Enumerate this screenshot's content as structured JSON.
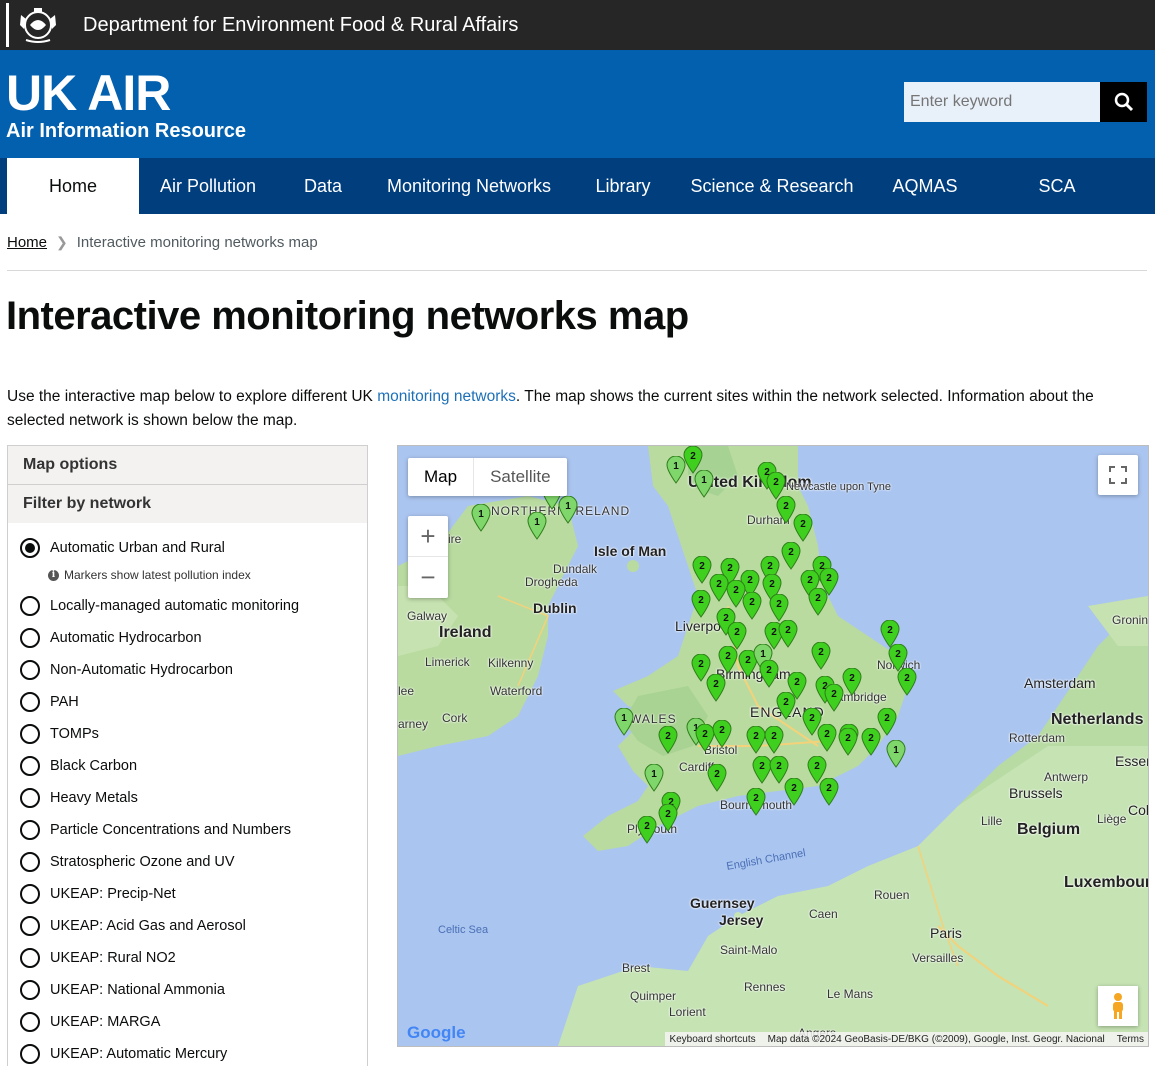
{
  "govbar": {
    "title": "Department for Environment Food & Rural Affairs"
  },
  "brand": {
    "title": "UK AIR",
    "subtitle": "Air Information Resource"
  },
  "search": {
    "placeholder": "Enter keyword"
  },
  "nav": [
    {
      "label": "Home",
      "active": true
    },
    {
      "label": "Air Pollution"
    },
    {
      "label": "Data"
    },
    {
      "label": "Monitoring Networks"
    },
    {
      "label": "Library"
    },
    {
      "label": "Science & Research"
    },
    {
      "label": "AQMAS"
    },
    {
      "label": "SCA"
    }
  ],
  "breadcrumb": {
    "home": "Home",
    "current": "Interactive monitoring networks map"
  },
  "page": {
    "title": "Interactive monitoring networks map",
    "intro_before": "Use the interactive map below to explore different UK ",
    "intro_link": "monitoring networks",
    "intro_after": ". The map shows the current sites within the network selected. Information about the selected network is shown below the map."
  },
  "options": {
    "heading": "Map options",
    "filter_heading": "Filter by network",
    "note": "Markers show latest pollution index",
    "networks": [
      {
        "label": "Automatic Urban and Rural",
        "selected": true
      },
      {
        "label": "Locally-managed automatic monitoring"
      },
      {
        "label": "Automatic Hydrocarbon"
      },
      {
        "label": "Non-Automatic Hydrocarbon"
      },
      {
        "label": "PAH"
      },
      {
        "label": "TOMPs"
      },
      {
        "label": "Black Carbon"
      },
      {
        "label": "Heavy Metals"
      },
      {
        "label": "Particle Concentrations and Numbers"
      },
      {
        "label": "Stratospheric Ozone and UV"
      },
      {
        "label": "UKEAP: Precip-Net"
      },
      {
        "label": "UKEAP: Acid Gas and Aerosol"
      },
      {
        "label": "UKEAP: Rural NO2"
      },
      {
        "label": "UKEAP: National Ammonia"
      },
      {
        "label": "UKEAP: MARGA"
      },
      {
        "label": "UKEAP: Automatic Mercury"
      }
    ]
  },
  "map": {
    "tab_map": "Map",
    "tab_satellite": "Satellite",
    "zoom_in": "+",
    "zoom_out": "−",
    "google": "Google",
    "keyboard": "Keyboard shortcuts",
    "mapdata": "Map data ©2024 GeoBasis-DE/BKG (©2009), Google, Inst. Geogr. Nacional",
    "terms": "Terms",
    "labels": {
      "united_kingdom": "United Kingdom",
      "northern_ireland": "NORTHERN IRELAND",
      "isle_of_man": "Isle of Man",
      "ireland": "Ireland",
      "dublin": "Dublin",
      "dundalk": "Dundalk",
      "drogheda": "Drogheda",
      "galway": "Galway",
      "limerick": "Limerick",
      "kilkenny": "Kilkenny",
      "waterford": "Waterford",
      "cork": "Cork",
      "newcastle": "Newcastle upon Tyne",
      "durham": "Durham",
      "liverpool": "Liverpool",
      "birmingham": "Birmingham",
      "england": "ENGLAND",
      "wales": "WALES",
      "cardiff": "Cardiff",
      "bristol": "Bristol",
      "plymouth": "Plymouth",
      "bournemouth": "Bournemouth",
      "cambridge": "Cambridge",
      "norwich": "Norwich",
      "english_channel": "English Channel",
      "celtic_sea": "Celtic Sea",
      "guernsey": "Guernsey",
      "jersey": "Jersey",
      "saint_malo": "Saint-Malo",
      "brest": "Brest",
      "quimper": "Quimper",
      "lorient": "Lorient",
      "rennes": "Rennes",
      "le_mans": "Le Mans",
      "caen": "Caen",
      "rouen": "Rouen",
      "paris": "Paris",
      "versailles": "Versailles",
      "amsterdam": "Amsterdam",
      "netherlands": "Netherlands",
      "rotterdam": "Rotterdam",
      "antwerp": "Antwerp",
      "brussels": "Brussels",
      "belgium": "Belgium",
      "lille": "Lille",
      "liege": "Liège",
      "luxembourg": "Luxembourg",
      "groningen": "Groningen",
      "essen": "Essen",
      "cologne": "Cologne",
      "ire": "ire",
      "arney": "arney",
      "tralee": "lee",
      "angers": "Angers"
    },
    "markers": [
      {
        "i": 1
      },
      {
        "i": 1
      },
      {
        "i": 1
      },
      {
        "i": 1
      },
      {
        "i": 1
      },
      {
        "i": 1
      },
      {
        "i": 2
      },
      {
        "i": 2
      },
      {
        "i": 2
      },
      {
        "i": 2
      },
      {
        "i": 2
      },
      {
        "i": 2
      },
      {
        "i": 2
      },
      {
        "i": 2
      },
      {
        "i": 2
      },
      {
        "i": 2
      },
      {
        "i": 2
      },
      {
        "i": 2
      },
      {
        "i": 2
      },
      {
        "i": 2
      },
      {
        "i": 2
      },
      {
        "i": 2
      },
      {
        "i": 2
      },
      {
        "i": 2
      },
      {
        "i": 2
      },
      {
        "i": 2
      },
      {
        "i": 2
      },
      {
        "i": 2
      },
      {
        "i": 2
      },
      {
        "i": 2
      },
      {
        "i": 2
      },
      {
        "i": 2
      },
      {
        "i": 2
      },
      {
        "i": 2
      },
      {
        "i": 2
      },
      {
        "i": 2
      },
      {
        "i": 1
      },
      {
        "i": 2
      },
      {
        "i": 2
      },
      {
        "i": 2
      },
      {
        "i": 2
      },
      {
        "i": 2
      },
      {
        "i": 2
      },
      {
        "i": 2
      },
      {
        "i": 2
      },
      {
        "i": 1
      },
      {
        "i": 1
      },
      {
        "i": 2
      },
      {
        "i": 2
      },
      {
        "i": 2
      },
      {
        "i": 2
      },
      {
        "i": 2
      },
      {
        "i": 2
      },
      {
        "i": 1
      },
      {
        "i": 2
      },
      {
        "i": 2
      },
      {
        "i": 2
      },
      {
        "i": 2
      },
      {
        "i": 2
      },
      {
        "i": 2
      },
      {
        "i": 2
      },
      {
        "i": 2
      },
      {
        "i": 2
      },
      {
        "i": 1
      },
      {
        "i": 2
      },
      {
        "i": 2
      },
      {
        "i": 2
      },
      {
        "i": 2
      },
      {
        "i": 2
      },
      {
        "i": 2
      }
    ]
  },
  "colors": {
    "brand_blue": "#0260af",
    "nav_blue": "#003e7e",
    "marker_green": "#3fcf1f",
    "link": "#1d70b8"
  }
}
